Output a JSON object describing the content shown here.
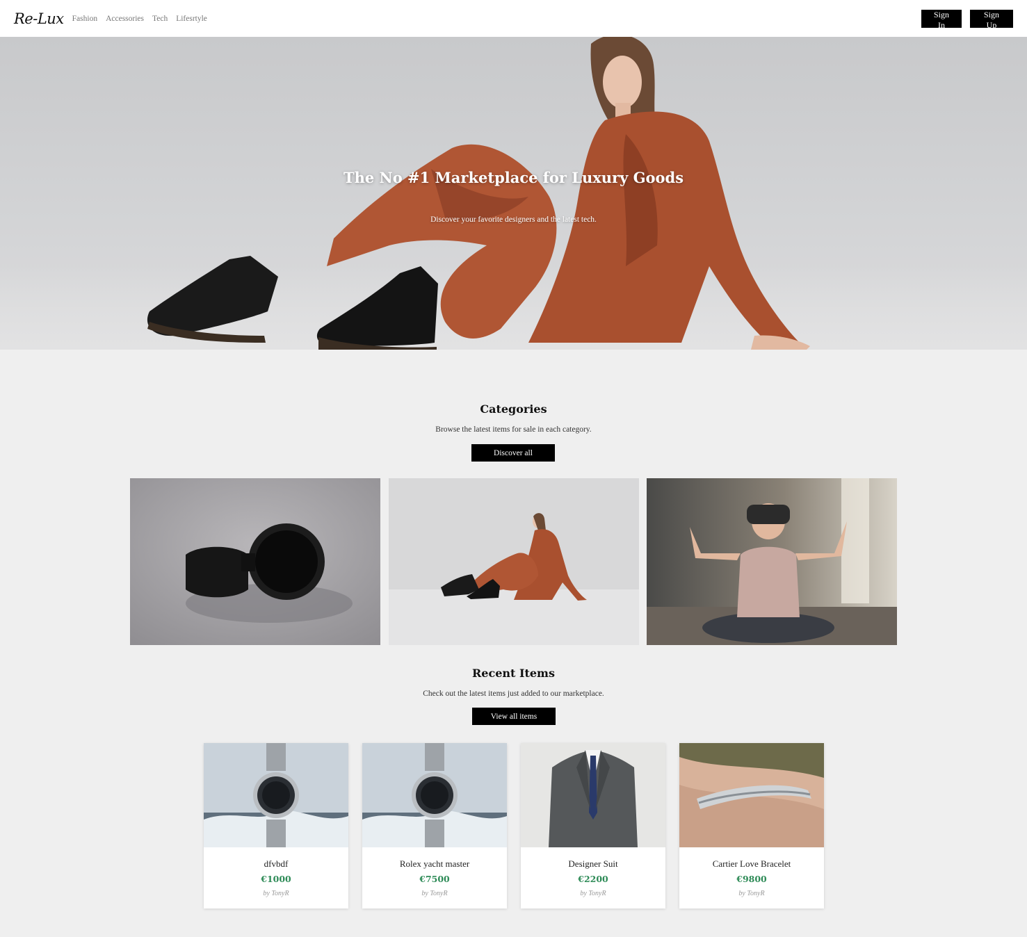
{
  "navbar": {
    "logo": "Re-Lux",
    "links": [
      "Fashion",
      "Accessories",
      "Tech",
      "Lifesrtyle"
    ],
    "sign_in": "Sign In",
    "sign_up": "Sign Up"
  },
  "hero": {
    "title": "The No #1 Marketplace for Luxury Goods",
    "subtitle": "Discover your favorite designers and the latest tech."
  },
  "categories": {
    "title": "Categories",
    "subtitle": "Browse the latest items for sale in each category.",
    "button": "Discover all",
    "tiles": [
      "smartwatch-photo",
      "fashion-model-photo",
      "vr-headset-photo"
    ]
  },
  "recent": {
    "title": "Recent Items",
    "subtitle": "Check out the latest items just added to our marketplace.",
    "button": "View all items",
    "items": [
      {
        "name": "dfvbdf",
        "price": "€1000",
        "seller": "by TonyR"
      },
      {
        "name": "Rolex yacht master",
        "price": "€7500",
        "seller": "by TonyR"
      },
      {
        "name": "Designer Suit",
        "price": "€2200",
        "seller": "by TonyR"
      },
      {
        "name": "Cartier Love Bracelet",
        "price": "€9800",
        "seller": "by TonyR"
      }
    ]
  },
  "colors": {
    "accent_price": "#2e8b57",
    "button_bg": "#000000",
    "page_bg": "#efefef"
  }
}
